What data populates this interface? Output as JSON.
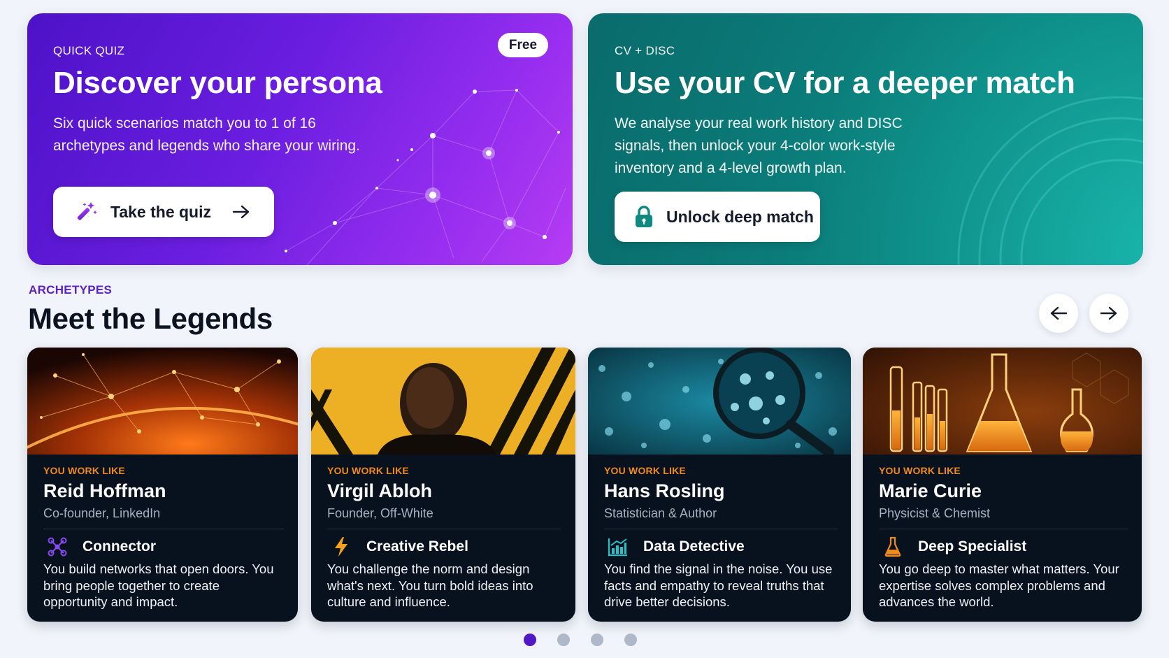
{
  "quiz_card": {
    "eyebrow": "QUICK QUIZ",
    "badge": "Free",
    "title": "Discover your persona",
    "description": "Six quick scenarios match you to 1 of 16 archetypes and legends who share your wiring.",
    "button_label": "Take the quiz",
    "button_icon": "magic-wand-icon"
  },
  "cv_card": {
    "eyebrow": "CV + DISC",
    "title": "Use your CV for a deeper match",
    "description": "We analyse your real work history and DISC signals, then unlock your 4-color work-style inventory and a 4-level growth plan.",
    "button_label": "Unlock deep match",
    "button_icon": "lock-icon"
  },
  "legends": {
    "eyebrow": "ARCHETYPES",
    "title": "Meet the Legends",
    "cards": [
      {
        "eyebrow": "YOU WORK LIKE",
        "name": "Reid Hoffman",
        "role": "Co-founder, LinkedIn",
        "archetype": "Connector",
        "icon": "network-icon",
        "description": "You build networks that open doors. You bring people together to create opportunity and impact."
      },
      {
        "eyebrow": "YOU WORK LIKE",
        "name": "Virgil Abloh",
        "role": "Founder, Off-White",
        "archetype": "Creative Rebel",
        "icon": "lightning-icon",
        "description": "You challenge the norm and design what's next. You turn bold ideas into culture and influence."
      },
      {
        "eyebrow": "YOU WORK LIKE",
        "name": "Hans Rosling",
        "role": "Statistician & Author",
        "archetype": "Data Detective",
        "icon": "chart-icon",
        "description": "You find the signal in the noise. You use facts and empathy to reveal truths that drive better decisions."
      },
      {
        "eyebrow": "YOU WORK LIKE",
        "name": "Marie Curie",
        "role": "Physicist & Chemist",
        "archetype": "Deep Specialist",
        "icon": "flask-icon",
        "description": "You go deep to master what matters. Your expertise solves complex problems and advances the world."
      }
    ]
  },
  "pagination": {
    "total": 4,
    "active": 1
  },
  "colors": {
    "accent": "#5218c4",
    "quiz_gradient": [
      "#4d12c8",
      "#b63cf2"
    ],
    "cv_gradient": [
      "#0a6b6b",
      "#19b7ad"
    ],
    "card_eyebrow": "#f08a1c",
    "card_bg": "#08121f"
  }
}
